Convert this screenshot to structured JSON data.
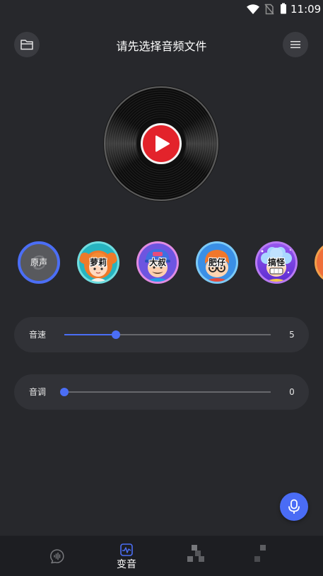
{
  "status_bar": {
    "time": "11:09",
    "icons": [
      "wifi-icon",
      "no-sim-icon",
      "battery-icon"
    ]
  },
  "header": {
    "title": "请先选择音频文件",
    "left_icon": "folder-icon",
    "right_icon": "menu-icon"
  },
  "player": {
    "center_icon": "play-icon"
  },
  "voices": [
    {
      "label": "原声",
      "selected": true
    },
    {
      "label": "萝莉",
      "selected": false
    },
    {
      "label": "大叔",
      "selected": false
    },
    {
      "label": "肥仔",
      "selected": false
    },
    {
      "label": "搞怪",
      "selected": false
    }
  ],
  "sliders": [
    {
      "label": "音速",
      "value": "5",
      "level": 0.25
    },
    {
      "label": "音调",
      "value": "0",
      "level": 0
    }
  ],
  "fab": {
    "icon": "microphone-icon"
  },
  "bottom_nav": [
    {
      "icon": "voice-wave-icon",
      "active": false
    },
    {
      "icon": "pulse-square-icon",
      "label": "变音",
      "active": true
    },
    {
      "icon": "mosaic-icon",
      "active": false
    },
    {
      "icon": "mosaic-icon",
      "active": false
    }
  ],
  "colors": {
    "accent": "#4b6ef5",
    "background": "#27282c",
    "card": "#313237",
    "play_button": "#e3232b"
  }
}
